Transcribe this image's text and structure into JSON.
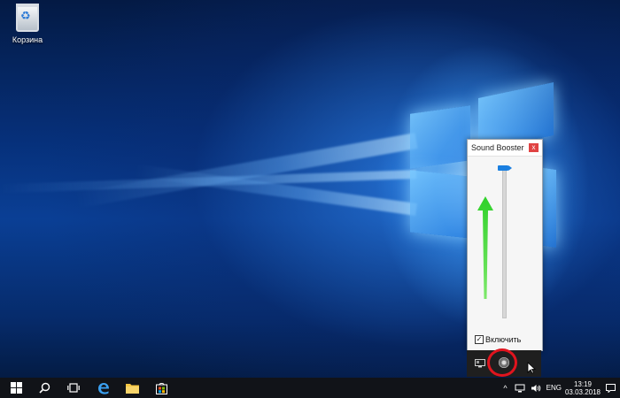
{
  "desktop": {
    "recycle_bin_label": "Корзина"
  },
  "sound_booster": {
    "title": "Sound Booster",
    "close_glyph": "x",
    "enable_checked": true,
    "enable_check_glyph": "✓",
    "enable_label": "Включить",
    "accent_color": "#1a7fe0",
    "volume_level_percent": 100
  },
  "taskbar": {
    "icons": [
      "windows-start-icon",
      "search-icon",
      "task-view-icon",
      "edge-icon",
      "file-explorer-icon",
      "store-icon"
    ],
    "tray_chevron": "^",
    "language": "ENG",
    "time": "13:19",
    "date": "03.03.2018"
  },
  "annotation": {
    "circle_color": "#e0141e",
    "arrow_color": "#33cc22"
  }
}
